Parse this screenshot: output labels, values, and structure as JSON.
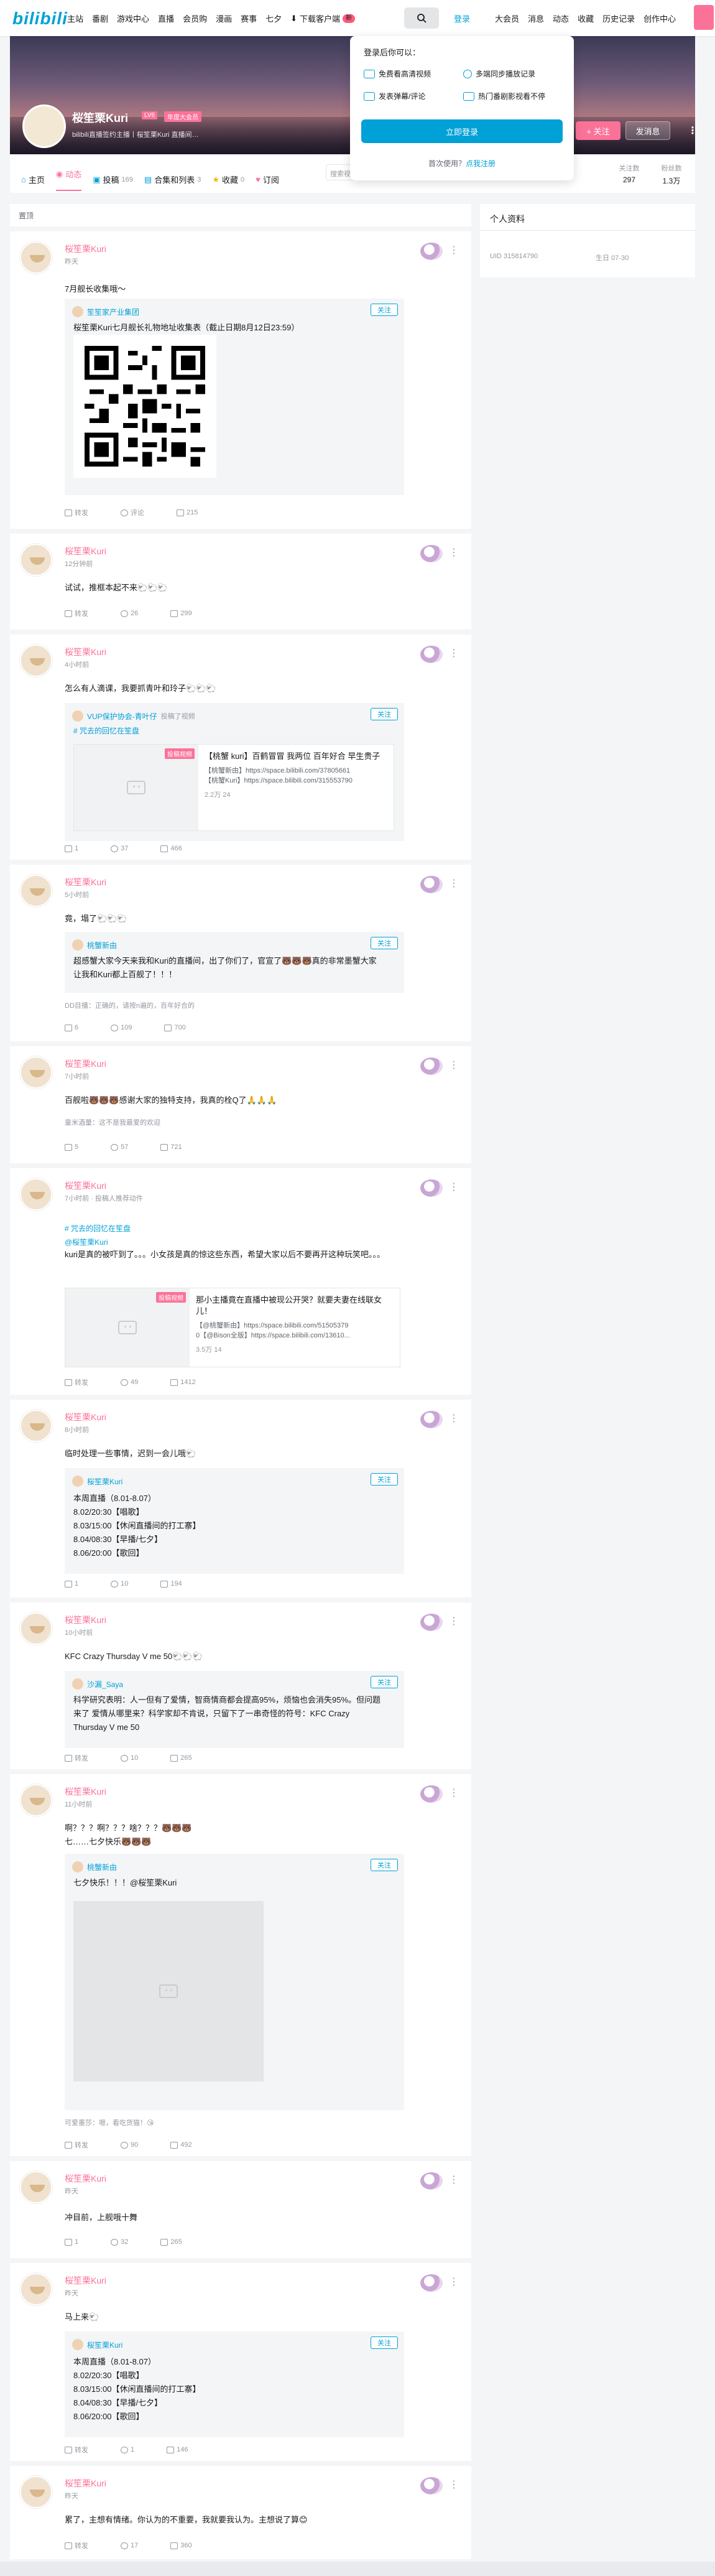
{
  "topbar": {
    "logo": "bilibili",
    "nav": [
      "主站",
      "番剧",
      "游戏中心",
      "直播",
      "会员购",
      "漫画",
      "赛事",
      "七夕"
    ],
    "download": "下载客户端",
    "download_badge": "新",
    "login": "登录",
    "right_nav": [
      "大会员",
      "消息",
      "动态",
      "收藏",
      "历史记录",
      "创作中心"
    ]
  },
  "profile": {
    "name": "桜笙栗Kuri",
    "level": "LV6",
    "vip": "年度大会员",
    "sign": "bilibili直播签约主播丨桜笙栗Kuri 直播间…",
    "follow": "+ 关注",
    "message": "发消息"
  },
  "tabs": [
    {
      "label": "主页",
      "count": ""
    },
    {
      "label": "动态",
      "count": ""
    },
    {
      "label": "投稿",
      "count": "169"
    },
    {
      "label": "合集和列表",
      "count": "3"
    },
    {
      "label": "收藏",
      "count": "0"
    },
    {
      "label": "订阅",
      "count": ""
    }
  ],
  "search_placeholder": "搜索视频、动态",
  "stats": {
    "following_label": "关注数",
    "following": "297",
    "followers_label": "粉丝数",
    "followers": "1.3万"
  },
  "popup": {
    "title": "登录后你可以：",
    "features": [
      "免费看高清视频",
      "多端同步播放记录",
      "发表弹幕/评论",
      "热门番剧影视看不停"
    ],
    "button": "立即登录",
    "register_prefix": "首次使用？",
    "register_link": "点我注册"
  },
  "dyn_header": "置顶",
  "sidebar": {
    "title": "个人资料",
    "uid": "UID 315814790",
    "birthday": "生日 07-30"
  },
  "posts": [
    {
      "name": "桜笙栗Kuri",
      "time": "昨天",
      "text": "7月舰长收集哦～",
      "repost_user": "笙笙家产业集团",
      "repost_text": "桜笙栗Kuri七月舰长礼物地址收集表（截止日期8月12日23:59）",
      "acts": [
        "转发",
        "评论",
        "215"
      ],
      "follow": "关注"
    },
    {
      "name": "桜笙栗Kuri",
      "time": "12分钟前",
      "text": "试试，推框本起不来🐑🐑🐑",
      "acts": [
        "转发",
        "26",
        "299"
      ]
    },
    {
      "name": "桜笙栗Kuri",
      "time": "4小时前",
      "text": "怎么有人滴课，我要抓青叶和玲子🐑🐑🐑",
      "repost_user": "VUP保护协会-青叶仔",
      "repost_extra": "投稿了视频",
      "topic": "# 咒去的回忆在笙盘",
      "vid_title": "【桃蟹 kuri】百鹤冒冒 我两位 百年好合 早生贵子",
      "vid_desc": "【桃蟹新由】https://space.bilibili.com/37805661\n【桃蟹Kuri】https://space.bilibili.com/315553790",
      "vid_stats": "2.2万   24",
      "tag": "投稿视频",
      "acts": [
        "1",
        "37",
        "466"
      ],
      "follow": "关注"
    },
    {
      "name": "桜笙栗Kuri",
      "time": "5小时前",
      "text": "竟，塌了🐑🐑🐑",
      "repost_user": "桃蟹新由",
      "repost_text": "超感蟹大家今天来我和Kuri的直播间，出了你们了，官宣了🐻🐻🐻真的非常墨蟹大家让我和Kuri都上百舰了！！！",
      "comment": "DD目播：正确的，请按n遍的，百年好合的",
      "acts": [
        "6",
        "109",
        "700"
      ],
      "follow": "关注"
    },
    {
      "name": "桜笙栗Kuri",
      "time": "7小时前",
      "text": "百舰啦🐻🐻🐻感谢大家的独特支持，我真的栓Q了🙏🙏🙏",
      "comment": "童米酒量：这不是我最爱的欢迎",
      "acts": [
        "5",
        "57",
        "721"
      ]
    },
    {
      "name": "桜笙栗Kuri",
      "time": "7小时前 · 投稿人推荐动件",
      "topic": "# 咒去的回忆在笙盘",
      "topic2": "@桜笙栗Kuri",
      "text": "kuri是真的被吓到了。。。小女孩是真的惊这些东西，希望大家以后不要再开这种玩笑吧。。。",
      "vid_title": "那小主播竟在直播中被现公开哭？就要夫妻在线联女儿！",
      "vid_desc": "【@桃蟹新由】https://space.bilibili.com/51505379\n0【@Bison全版】https://space.bilibili.com/13610...",
      "vid_stats": "3.5万   14",
      "tag": "投稿视频",
      "acts": [
        "转发",
        "49",
        "1412"
      ]
    },
    {
      "name": "桜笙栗Kuri",
      "time": "8小时前",
      "text": "临时处理一些事情，迟到一会儿哦🐑",
      "repost_user": "桜笙栗Kuri",
      "repost_text": "本周直播（8.01-8.07）\n8.02/20:30【唱歌】\n8.03/15:00【休闲直播间的打工寨】\n8.04/08:30【早播/七夕】\n8.06/20:00【歌回】",
      "acts": [
        "1",
        "10",
        "194"
      ],
      "follow": "关注"
    },
    {
      "name": "桜笙栗Kuri",
      "time": "10小时前",
      "text": "KFC Crazy Thursday V me 50🐑🐑🐑",
      "repost_user": "沙漏_Saya",
      "repost_text": "科学研究表明：人一但有了爱情，智商情商都会提高95%，烦恼也会消失95%。但问题来了 爱情从哪里来？科学家却不肯说，只留下了一串奇怪的符号：KFC Crazy Thursday V me 50",
      "acts": [
        "转发",
        "10",
        "265"
      ],
      "follow": "关注"
    },
    {
      "name": "桜笙栗Kuri",
      "time": "11小时前",
      "text": "啊？？？啊？？？啥？？？🐻🐻🐻\n七……七夕快乐🐻🐻🐻",
      "repost_user": "桃蟹新由",
      "repost_text": "七夕快乐！！！@桜笙栗Kuri",
      "comment": "可爱墨莎：嗯，看吃货猫！😘",
      "acts": [
        "转发",
        "90",
        "492"
      ],
      "follow": "关注"
    },
    {
      "name": "桜笙栗Kuri",
      "time": "昨天",
      "text": "冲目前，上舰哦十舞",
      "acts": [
        "1",
        "32",
        "265"
      ]
    },
    {
      "name": "桜笙栗Kuri",
      "time": "昨天",
      "text": "马上来🐑",
      "repost_user": "桜笙栗Kuri",
      "repost_text": "本周直播（8.01-8.07）\n8.02/20:30【唱歌】\n8.03/15:00【休闲直播间的打工寨】\n8.04/08:30【早播/七夕】\n8.06/20:00【歌回】",
      "acts": [
        "转发",
        "1",
        "146"
      ],
      "follow": "关注"
    },
    {
      "name": "桜笙栗Kuri",
      "time": "昨天",
      "text": "累了，主想有情绪。你认为的不重要，我就要我认为。主想说了算😊",
      "acts": [
        "转发",
        "17",
        "360"
      ]
    }
  ]
}
